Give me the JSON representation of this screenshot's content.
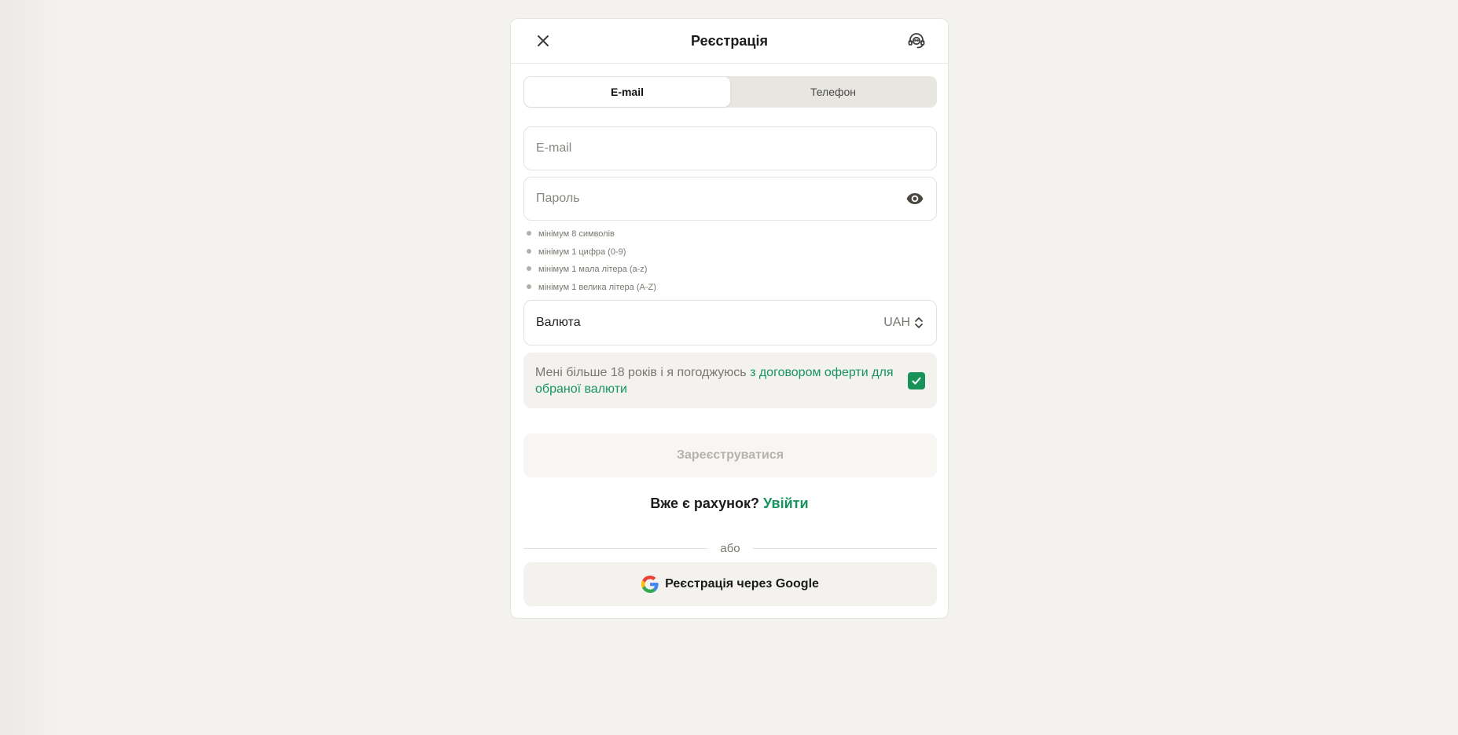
{
  "modal": {
    "title": "Реєстрація",
    "close_icon": "close-icon",
    "support_icon": "support-headset-icon"
  },
  "tabs": [
    {
      "label": "E-mail",
      "active": true
    },
    {
      "label": "Телефон",
      "active": false
    }
  ],
  "email_field": {
    "placeholder": "E-mail",
    "value": ""
  },
  "password_field": {
    "placeholder": "Пароль",
    "value": "",
    "toggle_icon": "eye-icon"
  },
  "password_rules": [
    "мінімум 8 символів",
    "мінімум 1 цифра (0-9)",
    "мінімум 1 мала літера (a-z)",
    "мінімум 1 велика літера (A-Z)"
  ],
  "currency": {
    "label": "Валюта",
    "value": "UAH",
    "icon": "select-arrows-icon"
  },
  "consent": {
    "text": "Мені більше 18 років і я погоджуюсь ",
    "link_text": "з договором оферти для обраної валюти",
    "checked": true
  },
  "submit": {
    "label": "Зареєструватися"
  },
  "login": {
    "question": "Вже є рахунок? ",
    "link_text": "Увійти"
  },
  "divider": {
    "label": "або"
  },
  "google": {
    "label": "Реєстрація через Google",
    "icon": "google-icon"
  },
  "colors": {
    "accent": "#16945c",
    "checkbox": "#17935a",
    "background": "#f3f2ef"
  }
}
